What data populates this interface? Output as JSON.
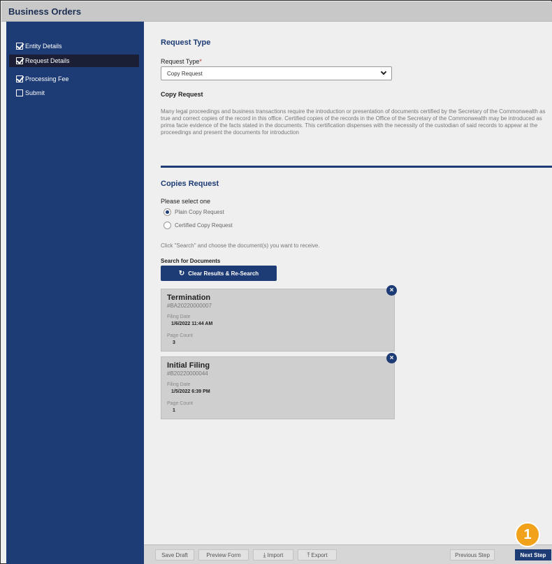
{
  "window": {
    "title": "Business Orders"
  },
  "sidebar": {
    "items": [
      {
        "label": "Entity Details",
        "checked": true,
        "active": false
      },
      {
        "label": "Request Details",
        "checked": true,
        "active": true
      },
      {
        "label": "Processing Fee",
        "checked": true,
        "active": false
      },
      {
        "label": "Submit",
        "checked": false,
        "active": false
      }
    ]
  },
  "request_type": {
    "heading": "Request Type",
    "field_label": "Request Type",
    "required_mark": "*",
    "selected_value": "Copy Request",
    "subheading": "Copy Request",
    "description": "Many legal proceedings and business transactions require the introduction or presentation of documents certified by the Secretary of the Commonwealth as true and correct copies of the record in this office. Certified copies of the records in the Office of the Secretary of the Commonwealth may be introduced as prima facie evidence of the facts stated in the documents. This certification dispenses with the necessity of the custodian of said records to appear at the proceedings and present the documents for introduction"
  },
  "copies_request": {
    "heading": "Copies Request",
    "select_label": "Please select one",
    "options": [
      {
        "label": "Plain Copy Request",
        "selected": true
      },
      {
        "label": "Certified Copy Request",
        "selected": false
      }
    ],
    "hint": "Click \"Search\" and choose the document(s) you want to receive.",
    "search_label": "Search for Documents",
    "clear_button": "Clear Results & Re-Search"
  },
  "documents": [
    {
      "title": "Termination",
      "number": "#BA20220000007",
      "filing_date_label": "Filing Date",
      "filing_date": "1/6/2022 11:44 AM",
      "page_count_label": "Page Count",
      "page_count": "3"
    },
    {
      "title": "Initial Filing",
      "number": "#B20220000044",
      "filing_date_label": "Filing Date",
      "filing_date": "1/5/2022 6:39 PM",
      "page_count_label": "Page Count",
      "page_count": "1"
    }
  ],
  "footer": {
    "save_draft": "Save Draft",
    "preview_form": "Preview Form",
    "import": "Import",
    "export": "Export",
    "previous_step": "Previous Step",
    "next_step": "Next Step"
  },
  "annotation": {
    "badge_number": "1",
    "badge_color": "#f2a11a"
  },
  "colors": {
    "brand_navy": "#1d3b74",
    "active_nav": "#1a1f35"
  }
}
